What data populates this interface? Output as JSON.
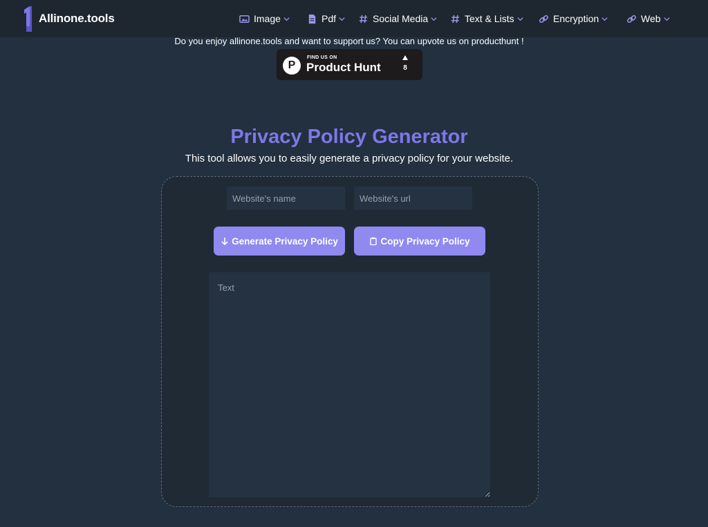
{
  "brand": {
    "name": "Allinone.tools",
    "accent": "#7c78e8",
    "button_color": "#8f89f0"
  },
  "nav": {
    "items": [
      {
        "label": "Image",
        "icon": "image-icon"
      },
      {
        "label": "Pdf",
        "icon": "pdf-file-icon"
      },
      {
        "label": "Social Media",
        "icon": "hashtag-icon"
      },
      {
        "label": "Text & Lists",
        "icon": "hashtag-icon"
      },
      {
        "label": "Encryption",
        "icon": "link-icon"
      },
      {
        "label": "Web",
        "icon": "link-icon"
      }
    ]
  },
  "support": {
    "text": "Do you enjoy allinone.tools and want to support us? You can upvote us on producthunt !",
    "badge": {
      "find_us": "FIND US ON",
      "name": "Product Hunt",
      "logo_letter": "P",
      "votes": "8"
    }
  },
  "tool": {
    "title": "Privacy Policy Generator",
    "description": "This tool allows you to easily generate a privacy policy for your website.",
    "website_name_placeholder": "Website's name",
    "website_url_placeholder": "Website's url",
    "generate_label": "Generate Privacy Policy",
    "copy_label": "Copy Privacy Policy",
    "text_placeholder": "Text"
  }
}
